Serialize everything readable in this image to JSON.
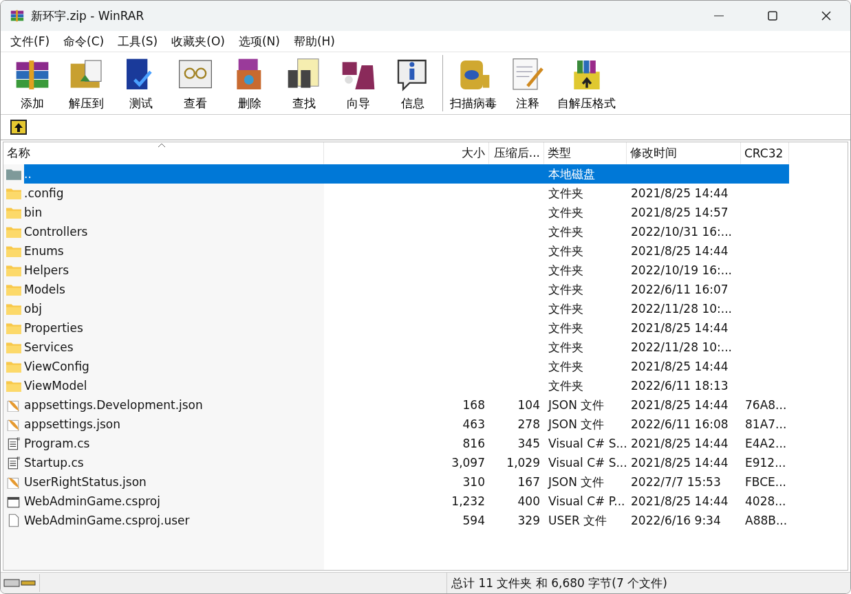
{
  "window": {
    "title": "新环宇.zip - WinRAR"
  },
  "menu": [
    "文件(F)",
    "命令(C)",
    "工具(S)",
    "收藏夹(O)",
    "选项(N)",
    "帮助(H)"
  ],
  "toolbar": [
    {
      "kind": "add",
      "label": "添加"
    },
    {
      "kind": "extract",
      "label": "解压到"
    },
    {
      "kind": "test",
      "label": "测试"
    },
    {
      "kind": "view",
      "label": "查看"
    },
    {
      "kind": "delete",
      "label": "删除"
    },
    {
      "kind": "find",
      "label": "查找"
    },
    {
      "kind": "wizard",
      "label": "向导"
    },
    {
      "kind": "info",
      "label": "信息"
    },
    {
      "kind": "scan",
      "label": "扫描病毒"
    },
    {
      "kind": "comment",
      "label": "注释"
    },
    {
      "kind": "sfx",
      "label": "自解压格式"
    }
  ],
  "table": {
    "columns": [
      "名称",
      "大小",
      "压缩后...",
      "类型",
      "修改时间",
      "CRC32"
    ],
    "rows": [
      {
        "kind": "up",
        "name": "..",
        "size": "",
        "packed": "",
        "type": "本地磁盘",
        "modified": "",
        "crc": "",
        "selected": true
      },
      {
        "kind": "folder",
        "name": ".config",
        "size": "",
        "packed": "",
        "type": "文件夹",
        "modified": "2021/8/25 14:44",
        "crc": "",
        "selected": false
      },
      {
        "kind": "folder",
        "name": "bin",
        "size": "",
        "packed": "",
        "type": "文件夹",
        "modified": "2021/8/25 14:57",
        "crc": "",
        "selected": false
      },
      {
        "kind": "folder",
        "name": "Controllers",
        "size": "",
        "packed": "",
        "type": "文件夹",
        "modified": "2022/10/31 16:...",
        "crc": "",
        "selected": false
      },
      {
        "kind": "folder",
        "name": "Enums",
        "size": "",
        "packed": "",
        "type": "文件夹",
        "modified": "2021/8/25 14:44",
        "crc": "",
        "selected": false
      },
      {
        "kind": "folder",
        "name": "Helpers",
        "size": "",
        "packed": "",
        "type": "文件夹",
        "modified": "2022/10/19 16:...",
        "crc": "",
        "selected": false
      },
      {
        "kind": "folder",
        "name": "Models",
        "size": "",
        "packed": "",
        "type": "文件夹",
        "modified": "2022/6/11 16:07",
        "crc": "",
        "selected": false
      },
      {
        "kind": "folder",
        "name": "obj",
        "size": "",
        "packed": "",
        "type": "文件夹",
        "modified": "2022/11/28 10:...",
        "crc": "",
        "selected": false
      },
      {
        "kind": "folder",
        "name": "Properties",
        "size": "",
        "packed": "",
        "type": "文件夹",
        "modified": "2021/8/25 14:44",
        "crc": "",
        "selected": false
      },
      {
        "kind": "folder",
        "name": "Services",
        "size": "",
        "packed": "",
        "type": "文件夹",
        "modified": "2022/11/28 10:...",
        "crc": "",
        "selected": false
      },
      {
        "kind": "folder",
        "name": "ViewConfig",
        "size": "",
        "packed": "",
        "type": "文件夹",
        "modified": "2021/8/25 14:44",
        "crc": "",
        "selected": false
      },
      {
        "kind": "folder",
        "name": "ViewModel",
        "size": "",
        "packed": "",
        "type": "文件夹",
        "modified": "2022/6/11 18:13",
        "crc": "",
        "selected": false
      },
      {
        "kind": "json",
        "name": "appsettings.Development.json",
        "size": "168",
        "packed": "104",
        "type": "JSON 文件",
        "modified": "2021/8/25 14:44",
        "crc": "76A8...",
        "selected": false
      },
      {
        "kind": "json",
        "name": "appsettings.json",
        "size": "463",
        "packed": "278",
        "type": "JSON 文件",
        "modified": "2022/6/11 16:08",
        "crc": "81A7...",
        "selected": false
      },
      {
        "kind": "cs",
        "name": "Program.cs",
        "size": "816",
        "packed": "345",
        "type": "Visual C# S...",
        "modified": "2021/8/25 14:44",
        "crc": "E4A2...",
        "selected": false
      },
      {
        "kind": "cs",
        "name": "Startup.cs",
        "size": "3,097",
        "packed": "1,029",
        "type": "Visual C# S...",
        "modified": "2021/8/25 14:44",
        "crc": "E912...",
        "selected": false
      },
      {
        "kind": "json",
        "name": "UserRightStatus.json",
        "size": "310",
        "packed": "167",
        "type": "JSON 文件",
        "modified": "2022/7/7 15:53",
        "crc": "FBCE...",
        "selected": false
      },
      {
        "kind": "csproj",
        "name": "WebAdminGame.csproj",
        "size": "1,232",
        "packed": "400",
        "type": "Visual C# P...",
        "modified": "2021/8/25 14:44",
        "crc": "4028...",
        "selected": false
      },
      {
        "kind": "file",
        "name": "WebAdminGame.csproj.user",
        "size": "594",
        "packed": "329",
        "type": "USER 文件",
        "modified": "2022/6/16 9:34",
        "crc": "A88B...",
        "selected": false
      }
    ]
  },
  "status_bar": {
    "text": "总计 11 文件夹 和 6,680 字节(7 个文件)"
  }
}
